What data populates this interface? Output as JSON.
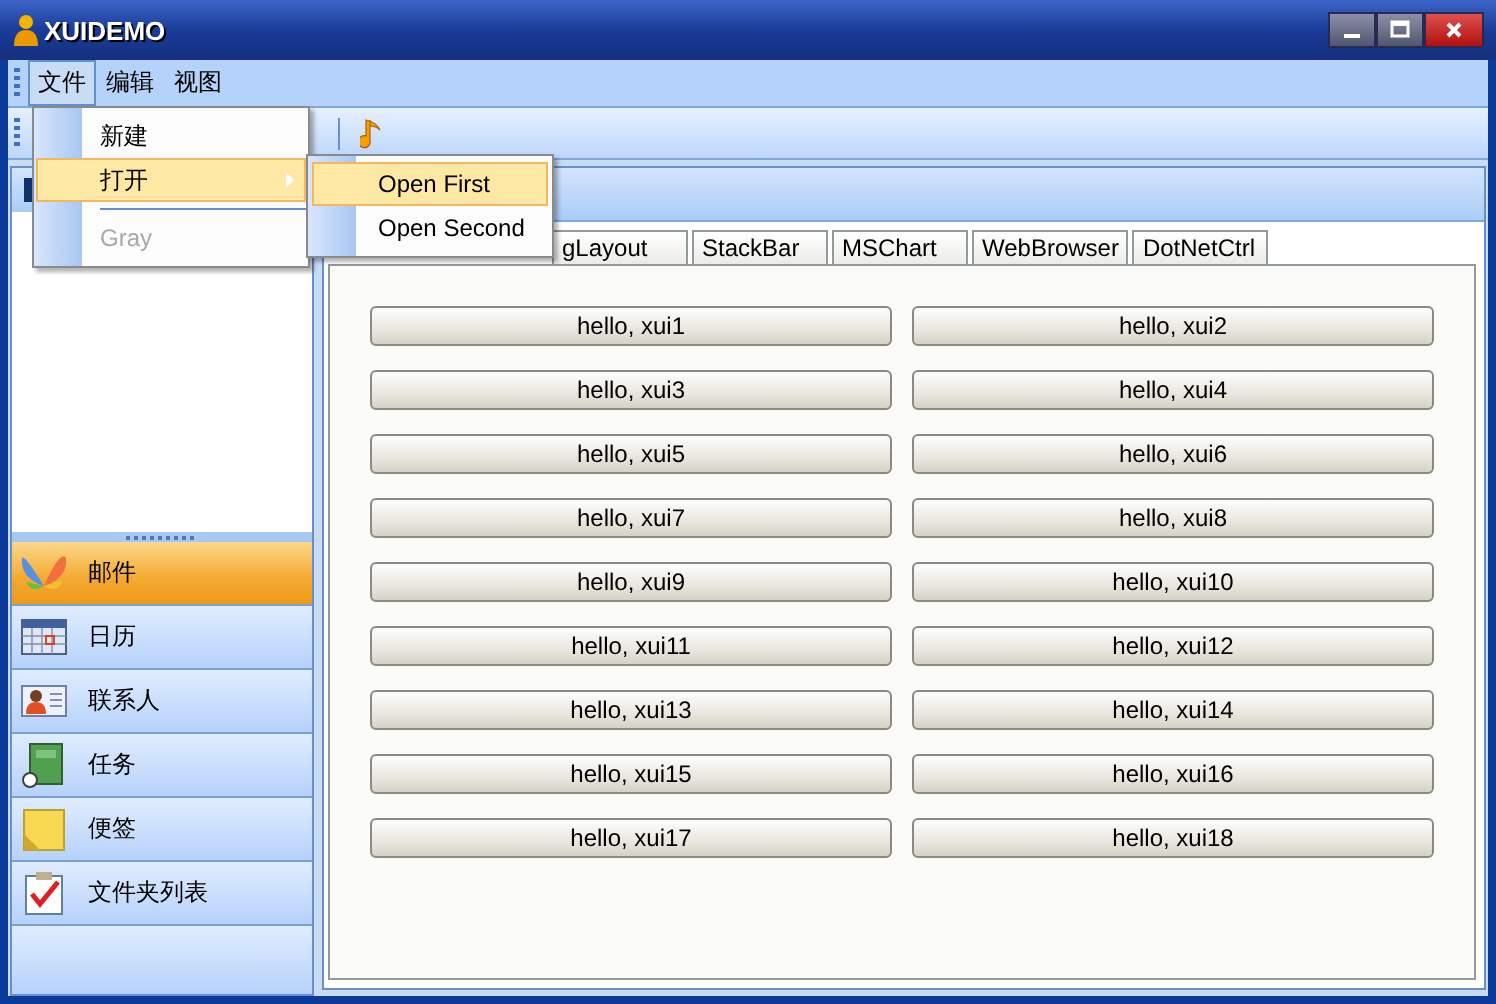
{
  "window": {
    "title": "XUIDEMO"
  },
  "menubar": [
    {
      "label": "文件",
      "selected": true
    },
    {
      "label": "编辑",
      "selected": false
    },
    {
      "label": "视图",
      "selected": false
    }
  ],
  "file_menu": [
    {
      "label": "新建",
      "kind": "item",
      "selected": false,
      "disabled": false,
      "submenu": false
    },
    {
      "label": "打开",
      "kind": "item",
      "selected": true,
      "disabled": false,
      "submenu": true
    },
    {
      "kind": "separator"
    },
    {
      "label": "Gray",
      "kind": "item",
      "selected": false,
      "disabled": true,
      "submenu": false
    }
  ],
  "open_submenu": [
    {
      "label": "Open First",
      "selected": true
    },
    {
      "label": "Open Second",
      "selected": false
    }
  ],
  "navigation": [
    {
      "label": "邮件",
      "selected": true
    },
    {
      "label": "日历",
      "selected": false
    },
    {
      "label": "联系人",
      "selected": false
    },
    {
      "label": "任务",
      "selected": false
    },
    {
      "label": "便签",
      "selected": false
    },
    {
      "label": "文件夹列表",
      "selected": false
    }
  ],
  "tabs": [
    {
      "label": "gLayout",
      "selected": false
    },
    {
      "label": "StackBar",
      "selected": false
    },
    {
      "label": "MSChart",
      "selected": false
    },
    {
      "label": "WebBrowser",
      "selected": false
    },
    {
      "label": "DotNetCtrl",
      "selected": false
    }
  ],
  "buttons": [
    "hello, xui1",
    "hello, xui2",
    "hello, xui3",
    "hello, xui4",
    "hello, xui5",
    "hello, xui6",
    "hello, xui7",
    "hello, xui8",
    "hello, xui9",
    "hello, xui10",
    "hello, xui11",
    "hello, xui12",
    "hello, xui13",
    "hello, xui14",
    "hello, xui15",
    "hello, xui16",
    "hello, xui17",
    "hello, xui18"
  ]
}
